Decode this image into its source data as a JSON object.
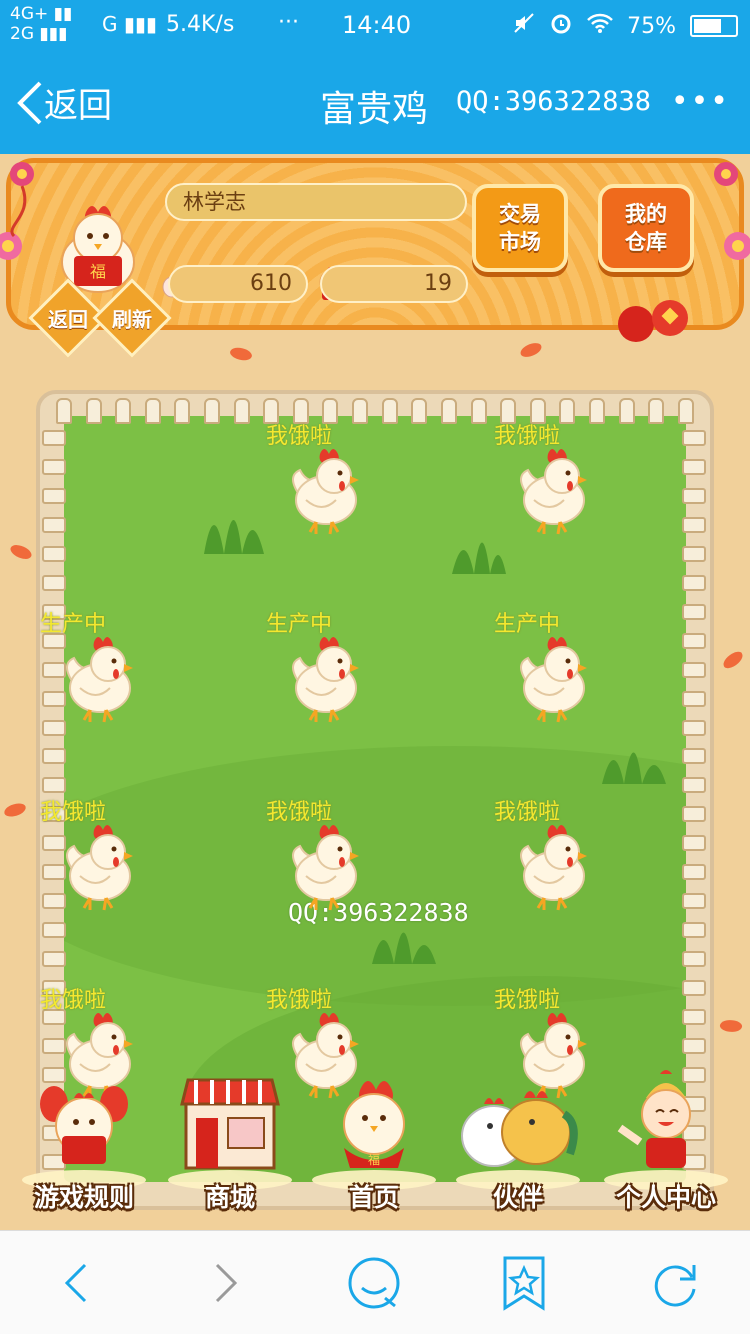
{
  "status_bar": {
    "network_top": "4G+",
    "network_bottom": "2G",
    "sim2": "G",
    "speed": "5.4K/s",
    "dots": "···",
    "time": "14:40",
    "battery": "75%",
    "battery_level": 0.75
  },
  "nav": {
    "back_label": "返回",
    "title": "富贵鸡",
    "qq": "QQ:396322838",
    "more": "•••"
  },
  "profile": {
    "name": "林学志",
    "eggs": "610",
    "chickens": "19"
  },
  "buttons": {
    "market": "交易市场",
    "store": "我的仓库",
    "return": "返回",
    "refresh": "刷新"
  },
  "farm": {
    "watermark": "QQ:396322838",
    "slots": [
      {
        "status": ""
      },
      {
        "status": "我饿啦"
      },
      {
        "status": "我饿啦"
      },
      {
        "status": "生产中"
      },
      {
        "status": "生产中"
      },
      {
        "status": "生产中"
      },
      {
        "status": "我饿啦"
      },
      {
        "status": "我饿啦"
      },
      {
        "status": "我饿啦"
      },
      {
        "status": "我饿啦"
      },
      {
        "status": "我饿啦"
      },
      {
        "status": "我饿啦"
      }
    ]
  },
  "dock": {
    "rules": "游戏规则",
    "shop": "商城",
    "home": "首页",
    "partner": "伙伴",
    "profile": "个人中心"
  },
  "colors": {
    "nav_bg": "#1aa7e8",
    "grass": "#7cc045",
    "status_text": "#f4e82f",
    "panel_orange": "#f39a16"
  }
}
